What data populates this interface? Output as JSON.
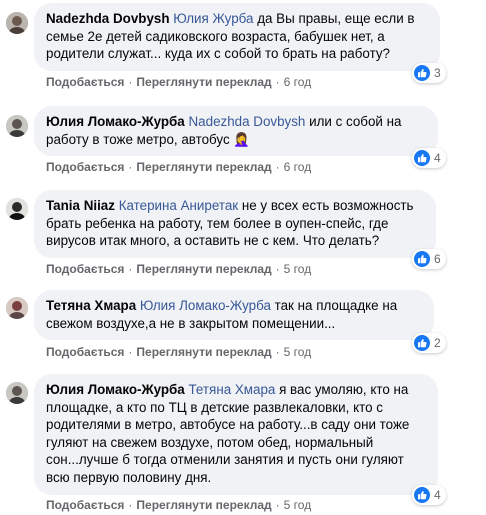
{
  "colors": {
    "bubble_bg": "#f0f2f5",
    "mention": "#385898",
    "meta_text": "#65676b",
    "like_blue": "#1877f2"
  },
  "comments": [
    {
      "author": "Nadezhda Dovbysh",
      "mention": "Юлия Журба",
      "text": " да Вы правы, еще если в семье 2е детей садиковского возраста, бабушек нет, а родители служат... куда их с собой то брать на работу?",
      "like_label": "Подобається",
      "translate_label": "Переглянути переклад",
      "time": "6 год",
      "reaction_count": "3",
      "reaction_icon": "like-icon"
    },
    {
      "author": "Юлия Ломако-Журба",
      "mention": "Nadezhda Dovbysh",
      "text": " или с собой на работу в тоже метро, автобус 🤦‍♀️",
      "like_label": "Подобається",
      "translate_label": "Переглянути переклад",
      "time": "6 год",
      "reaction_count": "4",
      "reaction_icon": "like-icon"
    },
    {
      "author": "Tania Niiaz",
      "mention": "Катерина Аниретак",
      "text": " не у всех есть возможность брать ребенка на работу, тем более в оупен-спейс, где вирусов итак много, а оставить не с кем. Что делать?",
      "like_label": "Подобається",
      "translate_label": "Переглянути переклад",
      "time": "5 год",
      "reaction_count": "6",
      "reaction_icon": "like-icon"
    },
    {
      "author": "Тетяна Хмара",
      "mention": "Юлия Ломако-Журба",
      "text": " так на площадке на свежом воздухе,а не в закрытом помещении...",
      "like_label": "Подобається",
      "translate_label": "Переглянути переклад",
      "time": "5 год",
      "reaction_count": "2",
      "reaction_icon": "like-icon"
    },
    {
      "author": "Юлия Ломако-Журба",
      "mention": "Тетяна Хмара",
      "text": " я вас умоляю, кто на площадке, а кто по ТЦ в детские развлекаловки, кто с родителями в метро, автобусе на работу...в саду они тоже гуляют на свежем воздухе, потом обед, нормальный сон...лучше б тогда отменили занятия и пусть они гуляют всю первую половину дня.",
      "like_label": "Подобається",
      "translate_label": "Переглянути переклад",
      "time": "5 год",
      "reaction_count": "4",
      "reaction_icon": "like-icon"
    }
  ]
}
